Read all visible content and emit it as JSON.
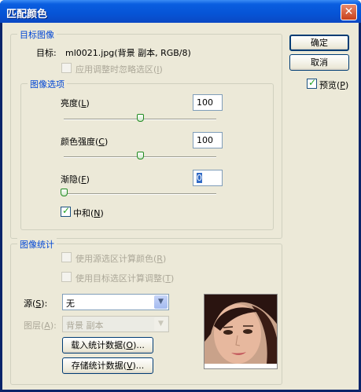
{
  "window": {
    "title": "匹配颜色",
    "close_glyph": "✕"
  },
  "target_image": {
    "group_title": "目标图像",
    "target_label": "目标:",
    "target_value": "ml0021.jpg(背景 副本, RGB/8)",
    "ignore_selection": {
      "text": "应用调整时忽略选区(",
      "key": "I",
      "suffix": ")",
      "checked": false,
      "enabled": false
    }
  },
  "image_options": {
    "group_title": "图像选项",
    "luminance": {
      "text": "亮度(",
      "key": "L",
      "suffix": ")",
      "value": "100",
      "slider_fraction": 0.5
    },
    "color_intensity": {
      "text": "颜色强度(",
      "key": "C",
      "suffix": ")",
      "value": "100",
      "slider_fraction": 0.5
    },
    "fade": {
      "text": "渐隐(",
      "key": "F",
      "suffix": ")",
      "value": "0",
      "slider_fraction": 0.0
    },
    "neutralize": {
      "text": "中和(",
      "key": "N",
      "suffix": ")",
      "checked": true
    }
  },
  "image_statistics": {
    "group_title": "图像统计",
    "use_source_selection": {
      "text": "使用源选区计算颜色(",
      "key": "R",
      "suffix": ")",
      "checked": false,
      "enabled": false
    },
    "use_target_selection": {
      "text": "使用目标选区计算调整(",
      "key": "T",
      "suffix": ")",
      "checked": false,
      "enabled": false
    },
    "source": {
      "text": "源(",
      "key": "S",
      "suffix": "):",
      "value": "无"
    },
    "layer": {
      "text": "图层(",
      "key": "A",
      "suffix": "):",
      "value": "背景 副本",
      "enabled": false
    },
    "load_stats": {
      "text": "载入统计数据(",
      "key": "O",
      "suffix": ")..."
    },
    "save_stats": {
      "text": "存储统计数据(",
      "key": "V",
      "suffix": ")..."
    }
  },
  "buttons": {
    "ok": "确定",
    "cancel": "取消",
    "preview": {
      "text": "预览(",
      "key": "P",
      "suffix": ")",
      "checked": true
    }
  },
  "colors": {
    "accent": "#0046d5",
    "dialog_bg": "#ece9d8",
    "title_bar": "#0654d6"
  }
}
